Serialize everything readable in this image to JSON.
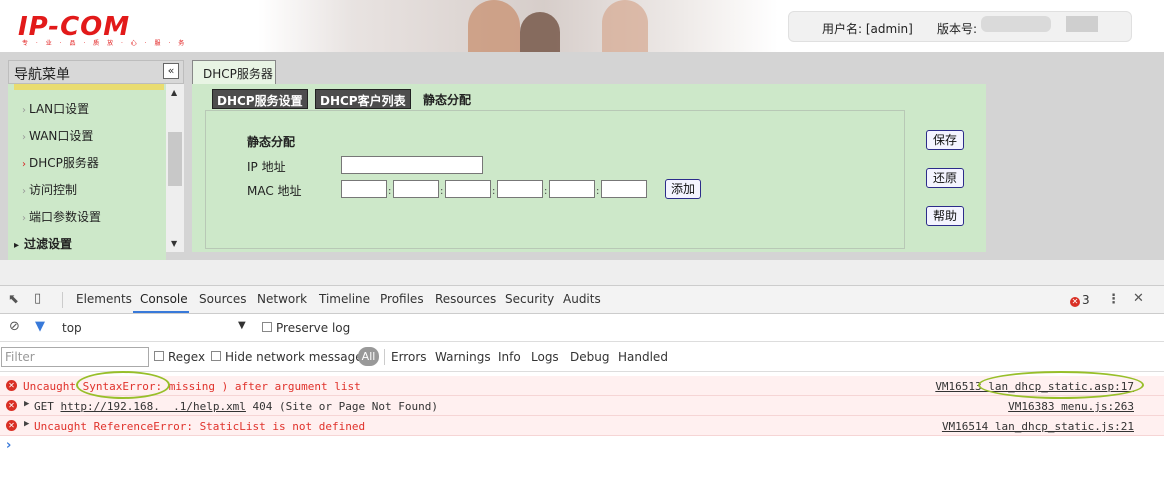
{
  "header": {
    "logo_text": "IP-COM",
    "logo_tagline": "专 · 业 · 品 · 质    放 · 心 · 服 · 务",
    "username_label": "用户名: [admin]",
    "version_label": "版本号:"
  },
  "nav": {
    "title": "导航菜单",
    "collapse_glyph": "«",
    "items": [
      {
        "label": "LAN口设置"
      },
      {
        "label": "WAN口设置"
      },
      {
        "label": "DHCP服务器"
      },
      {
        "label": "访问控制"
      },
      {
        "label": "端口参数设置"
      }
    ],
    "group": "过滤设置",
    "item_arrow": "›",
    "group_arrow": "▸"
  },
  "main": {
    "page_tab": "DHCP服务器",
    "subtabs": [
      "DHCP服务设置",
      "DHCP客户列表",
      "静态分配"
    ],
    "form": {
      "section_title": "静态分配",
      "ip_label": "IP 地址",
      "mac_label": "MAC 地址",
      "ip_value": "",
      "mac_values": [
        "",
        "",
        "",
        "",
        "",
        ""
      ],
      "mac_separator": ":",
      "add_button": "添加"
    },
    "buttons": {
      "save": "保存",
      "restore": "还原",
      "help": "帮助"
    }
  },
  "devtools": {
    "tabs": [
      "Elements",
      "Console",
      "Sources",
      "Network",
      "Timeline",
      "Profiles",
      "Resources",
      "Security",
      "Audits"
    ],
    "active_tab": "Console",
    "error_count": "3",
    "context": "top",
    "preserve_log": "Preserve log",
    "filter_placeholder": "Filter",
    "regex": "Regex",
    "hide_network": "Hide network messages",
    "levels": [
      "All",
      "Errors",
      "Warnings",
      "Info",
      "Logs",
      "Debug",
      "Handled"
    ],
    "messages": [
      {
        "level": "error",
        "text": "Uncaught SyntaxError: missing ) after argument list",
        "source": "VM16513 lan_dhcp_static.asp:17"
      },
      {
        "level": "error",
        "prefix": "GET ",
        "url": "http://192.168.  .1/help.xml",
        "text": " 404 (Site or Page Not Found)",
        "source": "VM16383 menu.js:263"
      },
      {
        "level": "error",
        "text": "Uncaught ReferenceError: StaticList is not defined",
        "source": "VM16514 lan_dhcp_static.js:21"
      }
    ],
    "prompt_glyph": "›"
  }
}
